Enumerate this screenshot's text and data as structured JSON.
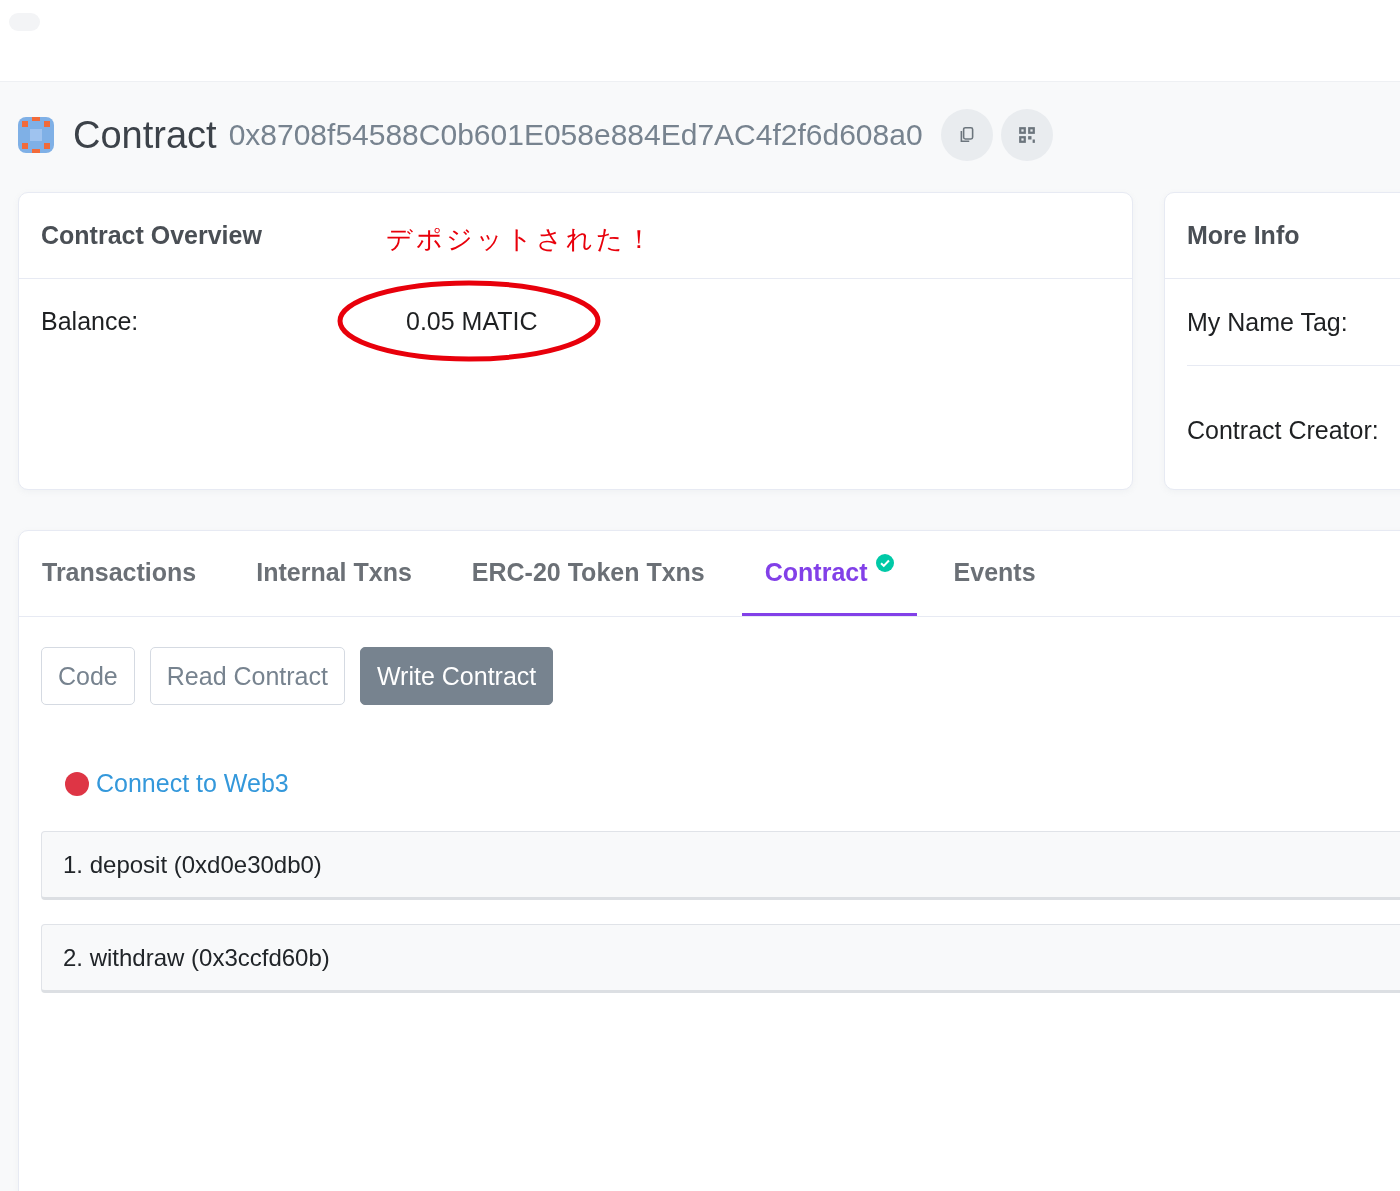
{
  "header": {
    "title": "Contract",
    "address": "0x8708f54588C0b601E058e884Ed7AC4f2f6d608a0"
  },
  "overview": {
    "title": "Contract Overview",
    "annotation": "デポジットされた！",
    "rows": [
      {
        "label": "Balance:",
        "value": "0.05 MATIC",
        "highlighted": true
      }
    ]
  },
  "more_info": {
    "title": "More Info",
    "rows": [
      {
        "label": "My Name Tag:"
      },
      {
        "label": "Contract Creator:"
      }
    ]
  },
  "tabs": [
    {
      "label": "Transactions",
      "selected": false,
      "verified": false
    },
    {
      "label": "Internal Txns",
      "selected": false,
      "verified": false
    },
    {
      "label": "ERC-20 Token Txns",
      "selected": false,
      "verified": false
    },
    {
      "label": "Contract",
      "selected": true,
      "verified": true
    },
    {
      "label": "Events",
      "selected": false,
      "verified": false
    }
  ],
  "subtabs": [
    {
      "label": "Code",
      "selected": false
    },
    {
      "label": "Read Contract",
      "selected": false
    },
    {
      "label": "Write Contract",
      "selected": true
    }
  ],
  "web3": {
    "label": "Connect to Web3",
    "connected": false
  },
  "functions": [
    {
      "label": "1. deposit (0xd0e30db0)"
    },
    {
      "label": "2. withdraw (0x3ccfd60b)"
    }
  ]
}
